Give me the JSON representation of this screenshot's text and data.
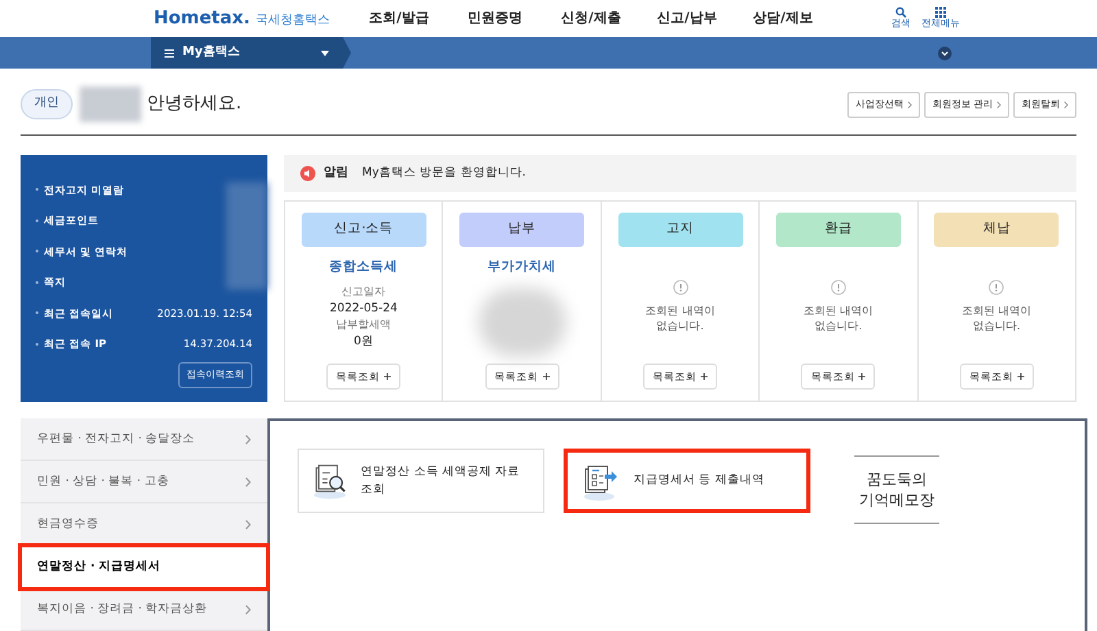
{
  "logo": {
    "brand": "Hometax.",
    "name": "국세청홈택스"
  },
  "nav": [
    "조회/발급",
    "민원증명",
    "신청/제출",
    "신고/납부",
    "상담/제보"
  ],
  "utility": [
    {
      "label": "검색",
      "kind": "search"
    },
    {
      "label": "전체메뉴",
      "kind": "grid"
    }
  ],
  "menubar": {
    "title": "My홈택스"
  },
  "greeting": {
    "badge": "개인",
    "text": "안녕하세요."
  },
  "account_buttons": [
    "사업장선택",
    "회원정보 관리",
    "회원탈퇴"
  ],
  "info_panel": {
    "rows": [
      {
        "label": "전자고지 미열람"
      },
      {
        "label": "세금포인트"
      },
      {
        "label": "세무서 및 연락처"
      },
      {
        "label": "쪽지"
      },
      {
        "label": "최근 접속일시",
        "value": "2023.01.19.  12:54"
      },
      {
        "label": "최근 접속 IP",
        "value": "14.37.204.14"
      }
    ],
    "button": "접속이력조회"
  },
  "notice": {
    "label": "알림",
    "message": "My홈택스 방문을 환영합니다."
  },
  "cards": [
    {
      "title": "신고·소득",
      "color": "#b9d9fb",
      "kind": "filed",
      "tax": "종합소득세",
      "details": [
        "신고일자",
        "2022-05-24",
        "납부할세액",
        "0원"
      ],
      "button": "목록조회"
    },
    {
      "title": "납부",
      "color": "#c3cdfb",
      "kind": "hidden",
      "tax": "부가가치세",
      "button": "목록조회"
    },
    {
      "title": "고지",
      "color": "#a0e2ef",
      "kind": "empty",
      "message": "조회된 내역이 없습니다.",
      "button": "목록조회"
    },
    {
      "title": "환급",
      "color": "#b2e8c9",
      "kind": "empty",
      "message": "조회된 내역이 없습니다.",
      "button": "목록조회"
    },
    {
      "title": "체납",
      "color": "#f3e0b5",
      "kind": "empty",
      "message": "조회된 내역이 없습니다.",
      "button": "목록조회"
    }
  ],
  "side_menu": [
    {
      "label": "우편물 · 전자고지 · 송달장소",
      "selected": false,
      "highlighted": false
    },
    {
      "label": "민원 · 상담 · 불복 · 고충",
      "selected": false,
      "highlighted": false
    },
    {
      "label": "현금영수증",
      "selected": false,
      "highlighted": false
    },
    {
      "label": "연말정산 · 지급명세서",
      "selected": true,
      "highlighted": true
    },
    {
      "label": "복지이음 · 장려금 · 학자금상환",
      "selected": false,
      "highlighted": false
    }
  ],
  "tiles": [
    {
      "label": "연말정산 소득 세액공제 자료 조회",
      "kind": "search-document",
      "highlighted": false
    },
    {
      "label": "지급명세서 등 제출내역",
      "kind": "submit-document",
      "highlighted": true
    }
  ],
  "memo": {
    "lines": [
      "꿈도둑의",
      "기억메모장"
    ]
  }
}
